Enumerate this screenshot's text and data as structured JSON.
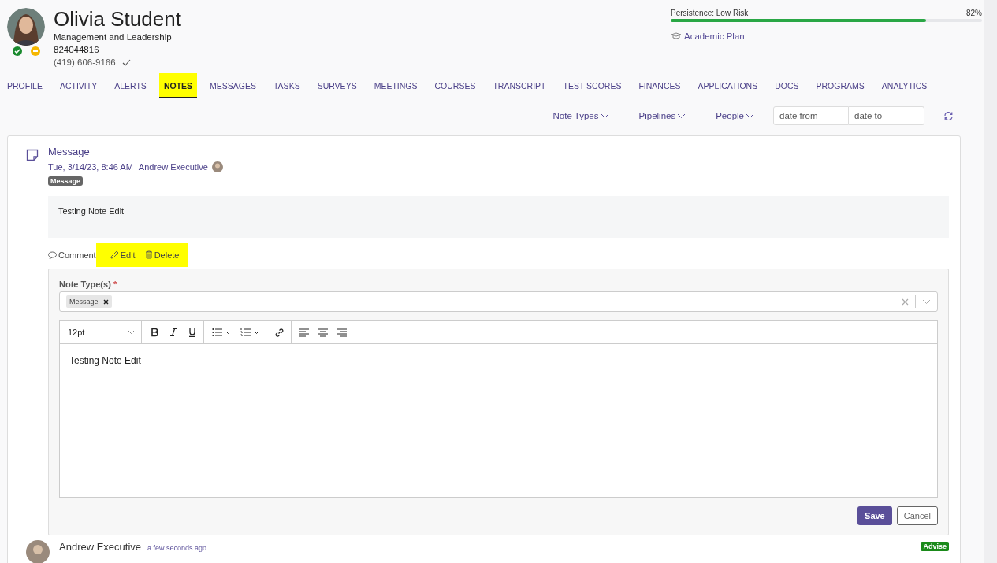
{
  "profile": {
    "name": "Olivia Student",
    "program": "Management and Leadership",
    "id": "824044816",
    "phone": "(419) 606-9166",
    "phone_verified": true
  },
  "persistence": {
    "label": "Persistence: Low Risk",
    "reading": "82%",
    "level": 0.82
  },
  "academic_plan": "Academic Plan",
  "tabs": [
    {
      "label": "PROFILE",
      "selected": false
    },
    {
      "label": "ACTIVITY",
      "selected": false
    },
    {
      "label": "ALERTS",
      "selected": false
    },
    {
      "label": "NOTES",
      "selected": true
    },
    {
      "label": "MESSAGES",
      "selected": false
    },
    {
      "label": "TASKS",
      "selected": false
    },
    {
      "label": "SURVEYS",
      "selected": false
    },
    {
      "label": "MEETINGS",
      "selected": false
    },
    {
      "label": "COURSES",
      "selected": false
    },
    {
      "label": "TRANSCRIPT",
      "selected": false
    },
    {
      "label": "TEST SCORES",
      "selected": false
    },
    {
      "label": "FINANCES",
      "selected": false
    },
    {
      "label": "APPLICATIONS",
      "selected": false
    },
    {
      "label": "DOCS",
      "selected": false
    },
    {
      "label": "PROGRAMS",
      "selected": false
    },
    {
      "label": "ANALYTICS",
      "selected": false
    }
  ],
  "filters": [
    "Note Types",
    "Pipelines",
    "People"
  ],
  "date_from": {
    "placeholder": "date from"
  },
  "date_to": {
    "placeholder": "date to"
  },
  "note": {
    "title": "Message",
    "timestamp": "Tue, 3/14/23, 8:46 AM",
    "author": "Andrew Executive",
    "tag": "Message",
    "body": "Testing Note Edit",
    "actions": [
      {
        "label": "Comment",
        "kind": "comment",
        "highlighted": false
      },
      {
        "label": "Edit",
        "kind": "edit",
        "highlighted": true
      },
      {
        "label": "Delete",
        "kind": "delete",
        "highlighted": true
      }
    ]
  },
  "editor": {
    "label": "Note Type(s)",
    "required": "*",
    "chips": [
      "Message"
    ],
    "font_size": "12pt",
    "content": "Testing Note Edit",
    "buttons": [
      {
        "label": "Save",
        "kind": "primary"
      },
      {
        "label": "Cancel",
        "kind": "secondary"
      }
    ]
  },
  "next_note": {
    "author": "Andrew Executive",
    "time": "a few seconds ago",
    "tag": "Advise"
  }
}
